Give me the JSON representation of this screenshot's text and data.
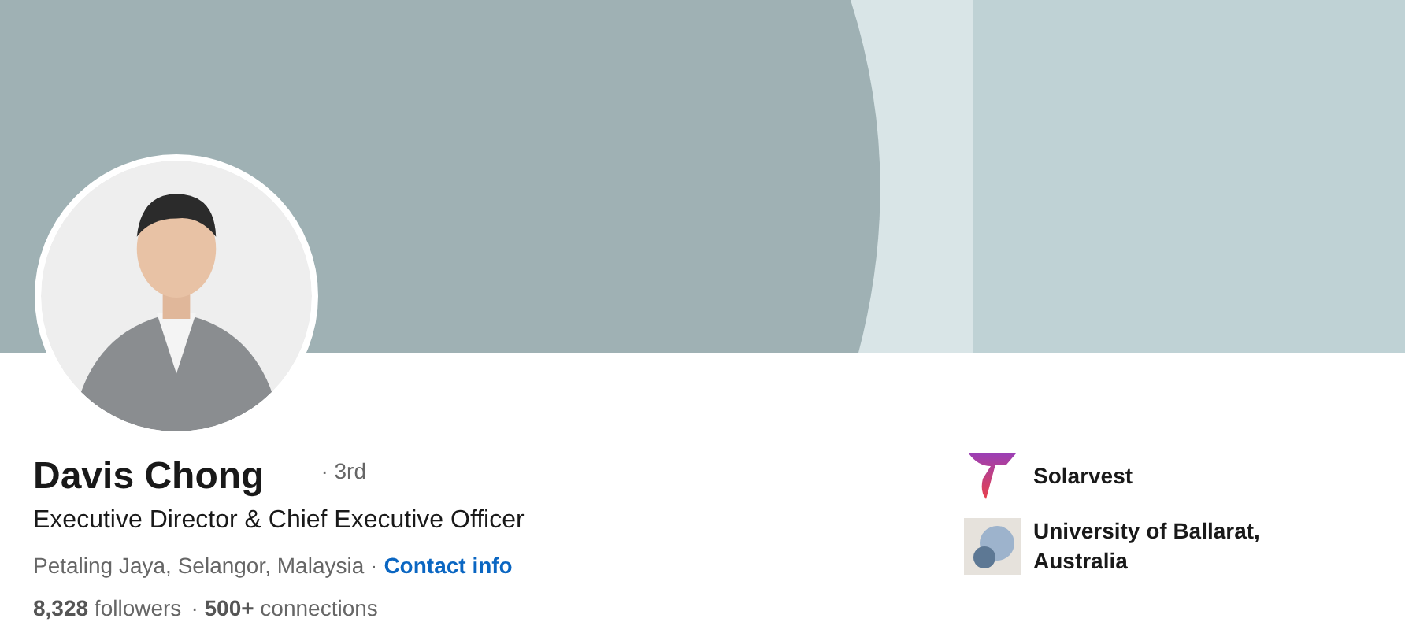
{
  "profile": {
    "name": "Davis Chong",
    "degree": "· 3rd",
    "headline": "Executive Director & Chief Executive Officer",
    "location": "Petaling Jaya, Selangor, Malaysia ·",
    "contact_link": "Contact info",
    "stats": [
      "**8,328** followers",
      "· **500+** connections"
    ]
  },
  "affiliations": [
    {
      "kind": "company",
      "name": "Solarvest"
    },
    {
      "kind": "school",
      "name": "University of Ballarat, Australia"
    }
  ]
}
